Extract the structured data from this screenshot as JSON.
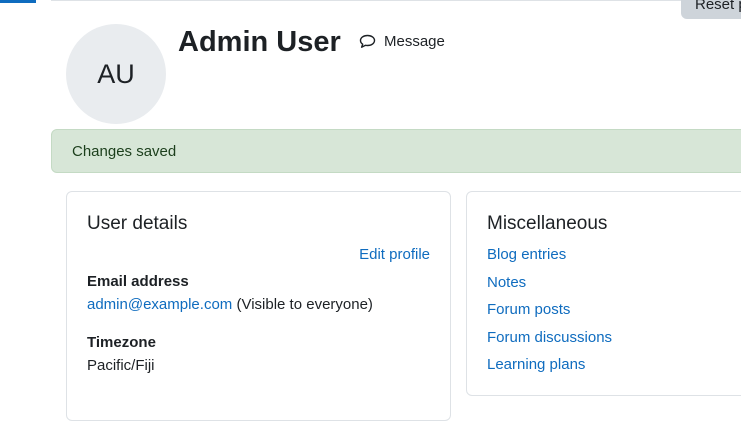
{
  "header": {
    "reset_button_label": "Reset page to default",
    "avatar_initials": "AU",
    "user_name": "Admin User",
    "message_label": "Message"
  },
  "alert": {
    "text": "Changes saved"
  },
  "user_details": {
    "title": "User details",
    "edit_profile_label": "Edit profile",
    "email_label": "Email address",
    "email_value": "admin@example.com",
    "email_visibility": "(Visible to everyone)",
    "timezone_label": "Timezone",
    "timezone_value": "Pacific/Fiji"
  },
  "miscellaneous": {
    "title": "Miscellaneous",
    "links": [
      "Blog entries",
      "Notes",
      "Forum posts",
      "Forum discussions",
      "Learning plans"
    ]
  },
  "colors": {
    "link": "#0f6cbf",
    "success_background": "#d7e6d7",
    "success_text": "#1c3f1c",
    "avatar_background": "#e9ecef",
    "border": "#dee2e6"
  },
  "icons": {
    "message": "speech-bubble-icon"
  }
}
